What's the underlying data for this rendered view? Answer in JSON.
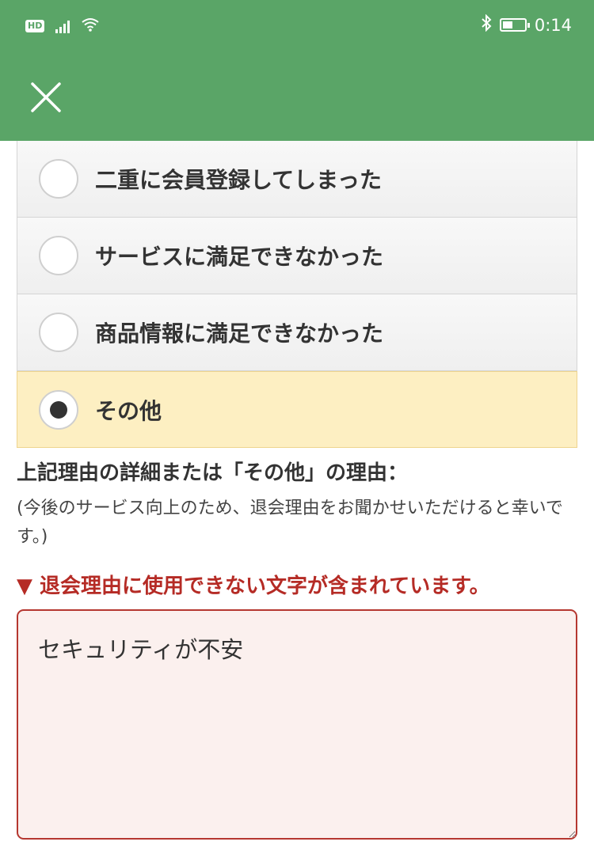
{
  "status_bar": {
    "hd_label": "HD",
    "time": "0:14",
    "battery_percent": 45
  },
  "reasons": [
    {
      "label": "二重に会員登録してしまった",
      "selected": false
    },
    {
      "label": "サービスに満足できなかった",
      "selected": false
    },
    {
      "label": "商品情報に満足できなかった",
      "selected": false
    },
    {
      "label": "その他",
      "selected": true
    }
  ],
  "detail": {
    "title": "上記理由の詳細または「その他」の理由：",
    "helper": "(今後のサービス向上のため、退会理由をお聞かせいただけると幸いです。)",
    "error": "▼ 退会理由に使用できない文字が含まれています。",
    "value": "セキュリティが不安"
  },
  "colors": {
    "header": "#5aa567",
    "selected_bg": "#fdefc2",
    "error": "#b52b25"
  }
}
